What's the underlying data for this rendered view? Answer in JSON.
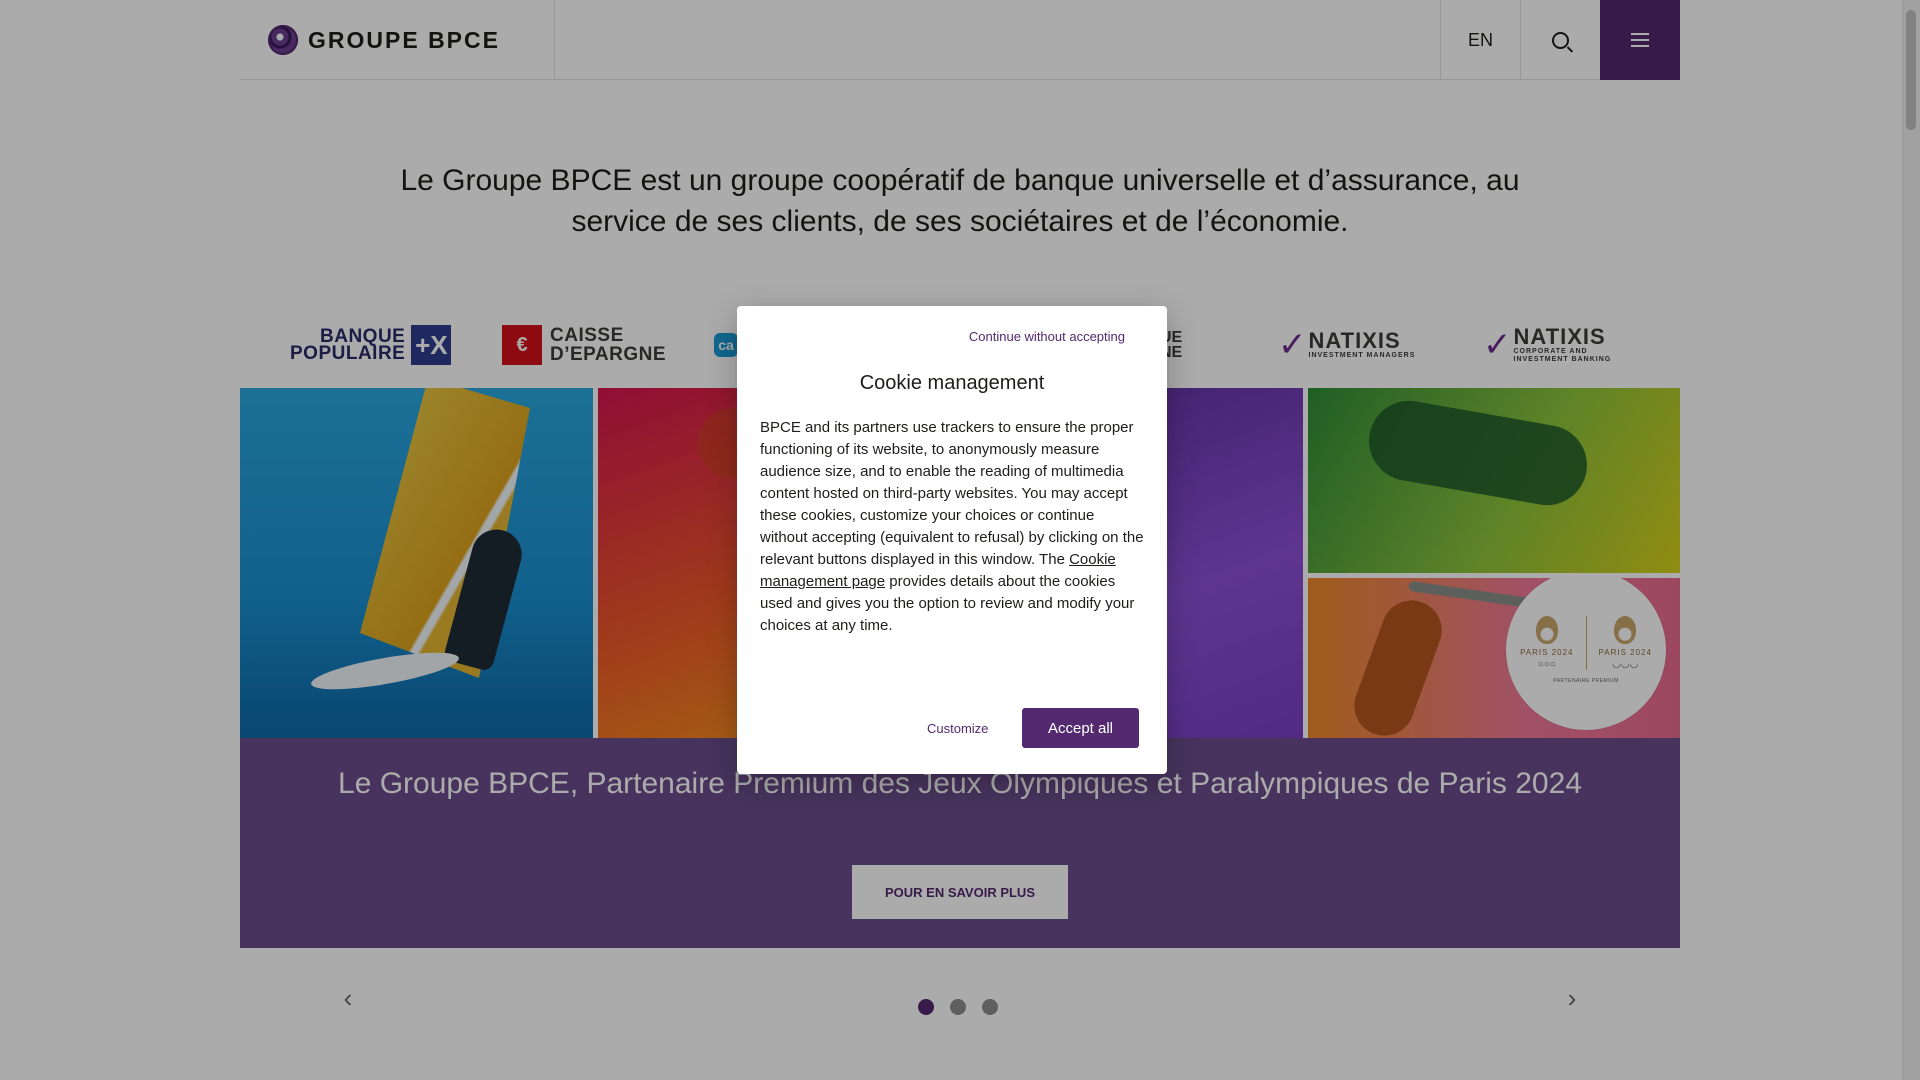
{
  "header": {
    "logo_text": "GROUPE BPCE",
    "language": "EN",
    "icons": {
      "search": "search-icon",
      "menu": "menu-icon"
    }
  },
  "intro": {
    "text": "Le Groupe BPCE est un groupe coopératif de banque universelle et d’assurance, au service de ses clients, de ses sociétaires et de l’économie."
  },
  "brands": {
    "banque_populaire": {
      "line1": "BANQUE",
      "line2": "POPULAIRE",
      "mark": "+X"
    },
    "caisse_epargne": {
      "line1": "CAISSE",
      "line2": "D’EPARGNE"
    },
    "partial_left": "ca",
    "partial_mid": {
      "line1": "UE",
      "line2": "NE"
    },
    "natixis_im": {
      "name": "NATIXIS",
      "sub": "INVESTMENT MANAGERS"
    },
    "natixis_cib": {
      "name": "NATIXIS",
      "sub1": "CORPORATE AND",
      "sub2": "INVESTMENT BANKING"
    }
  },
  "hero": {
    "badge": {
      "left": "PARIS 2024",
      "right": "PARIS 2024",
      "partner": "PARTENAIRE PREMIUM"
    },
    "title": "Le Groupe BPCE, Partenaire Premium des Jeux Olympiques et Paralympiques de Paris 2024",
    "cta": "POUR EN SAVOIR PLUS"
  },
  "carousel": {
    "slides": 3,
    "active": 1
  },
  "cookie_modal": {
    "skip": "Continue without accepting",
    "title": "Cookie management",
    "body_before": "BPCE and its partners use trackers to ensure the proper functioning of its website, to anonymously measure audience size, and to enable the reading of multimedia content hosted on third-party websites. You may accept these cookies, customize your choices or continue without accepting (equivalent to refusal) by clicking on the relevant buttons displayed in this window. The ",
    "body_link": "Cookie management page",
    "body_after": " provides details about the cookies used and gives you the option to review and modify your choices at any time.",
    "customize": "Customize",
    "accept": "Accept all"
  },
  "colors": {
    "brand_purple": "#54296f",
    "band_purple": "#6a4d8b",
    "overlay": "rgba(0,0,0,0.33)"
  }
}
